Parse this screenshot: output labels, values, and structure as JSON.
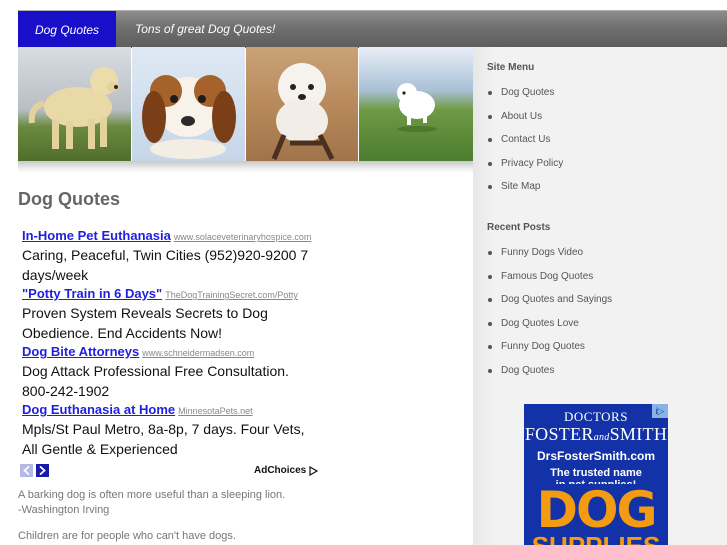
{
  "header": {
    "site_title": "Dog Quotes",
    "tagline": "Tons of great Dog Quotes!"
  },
  "main": {
    "page_title": "Dog Quotes",
    "ads": [
      {
        "title": "In-Home Pet Euthanasia",
        "url": "www.solaceveterinaryhospice.com",
        "desc": "Caring, Peaceful, Twin Cities (952)920-9200 7 days/week"
      },
      {
        "title": "\"Potty Train in 6 Days\"",
        "url": "TheDogTrainingSecret.com/Potty",
        "desc": "Proven System Reveals Secrets to Dog Obedience. End Accidents Now!"
      },
      {
        "title": "Dog Bite Attorneys",
        "url": "www.schneidermadsen.com",
        "desc": "Dog Attack Professional Free Consultation. 800-242-1902"
      },
      {
        "title": "Dog Euthanasia at Home",
        "url": "MinnesotaPets.net",
        "desc": "Mpls/St Paul Metro, 8a-8p, 7 days. Four Vets, All Gentle & Experienced"
      }
    ],
    "adchoices_label": "AdChoices",
    "quotes": [
      "A barking dog is often more useful than a sleeping lion.",
      "-Washington Irving",
      "Children are for people who can't have dogs."
    ]
  },
  "sidebar": {
    "site_menu_heading": "Site Menu",
    "site_menu": [
      "Dog Quotes",
      "About Us",
      "Contact Us",
      "Privacy Policy",
      "Site Map"
    ],
    "recent_posts_heading": "Recent Posts",
    "recent_posts": [
      "Funny Dogs Video",
      "Famous Dog Quotes",
      "Dog Quotes and Sayings",
      "Dog Quotes Love",
      "Funny Dog Quotes",
      "Dog Quotes"
    ]
  },
  "banner_ad": {
    "brand_line1": "DOCTORS",
    "brand_line2a": "FOSTER",
    "brand_and": "and",
    "brand_line2b": "SMITH",
    "site": "DrsFosterSmith.com",
    "message_line1": "The trusted name",
    "message_line2": "in pet supplies!",
    "big_text": "DOG",
    "big_text2": "SUPPLIES",
    "badge": "i▷"
  },
  "colors": {
    "title_bg": "#1a0fc8",
    "link_blue": "#1f1fe0",
    "header_gray": "#6f6f6f",
    "sidebar_bg": "#f2f2f2",
    "ad_blue": "#1432a8",
    "ad_orange": "#f39c12"
  }
}
